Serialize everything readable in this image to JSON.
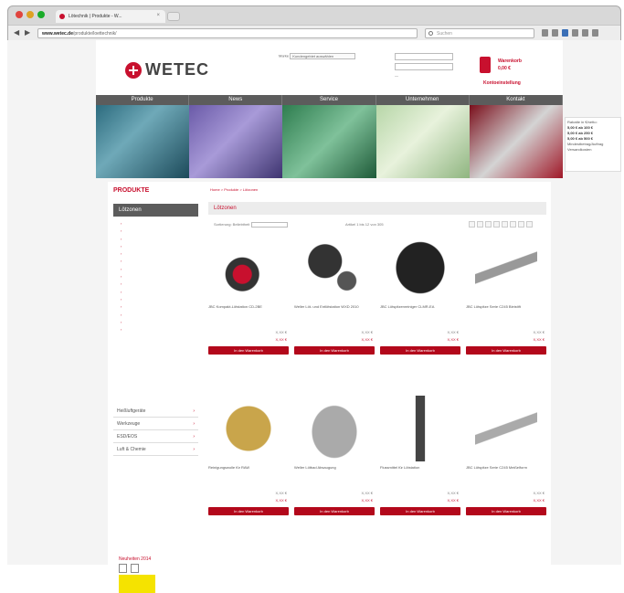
{
  "browser": {
    "tab_title": "Lötechnik | Produkte - W...",
    "url_domain": "www.wetec.de",
    "url_rest": "/produkte/loettechnik/",
    "search_placeholder": "Suchen"
  },
  "header": {
    "logo_text": "WETEC",
    "select_label": "Marke",
    "select_value": "Kundengebiet auswählen",
    "cart_label": "Warenkorb",
    "cart_value": "0,00 €",
    "cart_checkout": "Kontoeinstellung"
  },
  "nav": [
    "Produkte",
    "News",
    "Service",
    "Unternehmen",
    "Kontakt"
  ],
  "sidebox": [
    "Rabatte in €/netto:",
    "5,00 € ab 100 €",
    "5,00 € ab 250 €",
    "5,00 € ab 500 €",
    "Mindestbetrag/Auftrag",
    "Versandkosten"
  ],
  "sidebar": {
    "title": "PRODUKTE",
    "active": "Lötzonen",
    "categories": [
      "Heißluftgeräte",
      "Werkzeuge",
      "ESD/EOS",
      "Luft & Chemie"
    ],
    "news": "Neuheiten 2014"
  },
  "breadcrumb": "Home > Produkte > Lötzonen",
  "category_title": "Lötzonen",
  "sortbar": {
    "sort_label": "Sortierung: Beliebtheit",
    "count_label": "Artikel 1 bis 12 von 305"
  },
  "products": [
    {
      "name": "JBC Kompakt-Lötstation CD-2BE",
      "note": "",
      "price1": "X,XX €",
      "price2": "X,XX €",
      "btn": "In den Warenkorb"
    },
    {
      "name": "Weller Löt- und Entlötstation WXD 2010",
      "note": "",
      "price1": "X,XX €",
      "price2": "X,XX €",
      "btn": "In den Warenkorb"
    },
    {
      "name": "JBC Lötspitzenreiniger CLMR-EA",
      "note": "",
      "price1": "X,XX €",
      "price2": "X,XX €",
      "btn": "In den Warenkorb"
    },
    {
      "name": "JBC Lötspitze Serie C245 Bleistift",
      "note": "",
      "price1": "X,XX €",
      "price2": "X,XX €",
      "btn": "In den Warenkorb"
    },
    {
      "name": "Reinigungswolle für RAW",
      "note": "",
      "price1": "X,XX €",
      "price2": "X,XX €",
      "btn": "In den Warenkorb"
    },
    {
      "name": "Weller Lötbad Absaugung",
      "note": "",
      "price1": "X,XX €",
      "price2": "X,XX €",
      "btn": "In den Warenkorb"
    },
    {
      "name": "Flussmittel für Lötstation",
      "note": "",
      "price1": "X,XX €",
      "price2": "X,XX €",
      "btn": "In den Warenkorb"
    },
    {
      "name": "JBC Lötspitze Serie C245 Meißelform",
      "note": "",
      "price1": "X,XX €",
      "price2": "X,XX €",
      "btn": "In den Warenkorb"
    }
  ],
  "colors": {
    "brand": "#c8102e",
    "nav": "#5c5c5c"
  }
}
